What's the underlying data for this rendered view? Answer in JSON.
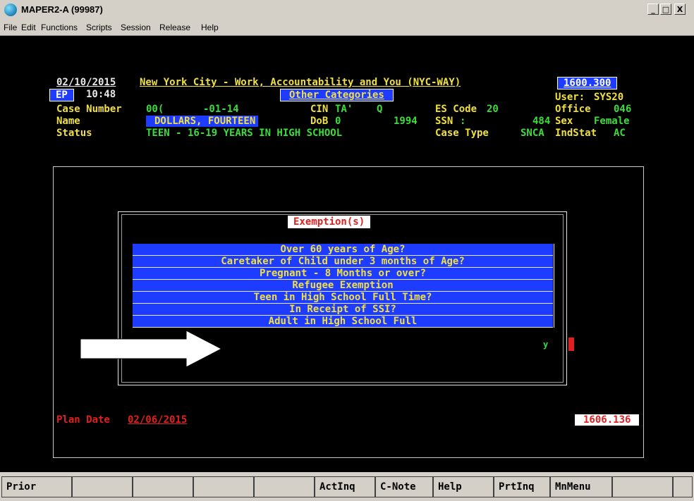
{
  "window": {
    "title": "MAPER2-A (99987)"
  },
  "window_buttons": {
    "minimize": "_",
    "maximize": "□",
    "close": "X"
  },
  "menu": [
    {
      "label": "File"
    },
    {
      "label": "Edit"
    },
    {
      "label": "Functions"
    },
    {
      "label": "Scripts"
    },
    {
      "label": "Session"
    },
    {
      "label": "Release"
    },
    {
      "label": "Help"
    }
  ],
  "header": {
    "date": "02/10/2015",
    "system_title": "New York City - Work, Accountability and You (NYC-WAY)",
    "screen_code": "1600.300",
    "mode": "EP",
    "time": "10:48",
    "category_tab": "Other Categories",
    "user_label": "User:",
    "user": "SYS20",
    "case_number_label": "Case Number",
    "case_number_a": "00(",
    "case_number_b": "-01-14",
    "cin_label": "CIN",
    "cin_a": "TA'",
    "cin_b": "Q",
    "es_code_label": "ES Code",
    "es_code": "20",
    "office_label": "Office",
    "office": "046",
    "name_label": "Name",
    "name": "DOLLARS, FOURTEEN",
    "dob_label": "DoB",
    "dob_a": "0",
    "dob_b": "1994",
    "ssn_label": "SSN",
    "ssn_a": ":",
    "ssn_b": "484",
    "sex_label": "Sex",
    "sex": "Female",
    "status_label": "Status",
    "status": "TEEN - 16-19 YEARS IN HIGH SCHOOL",
    "case_type_label": "Case Type",
    "case_type": "SNCA",
    "indstat_label": "IndStat",
    "indstat": "AC"
  },
  "dialog": {
    "title": "Exemption(s)",
    "options": [
      {
        "label": "Over 60 years of Age?"
      },
      {
        "label": "Caretaker of Child under 3 months of Age?"
      },
      {
        "label": "Pregnant - 8 Months or over?"
      },
      {
        "label": "Refugee Exemption"
      },
      {
        "label": "Teen in High School Full Time?"
      },
      {
        "label": "In Receipt of SSI?"
      },
      {
        "label": "Adult in High School Full"
      }
    ],
    "selected_value": "y"
  },
  "footer": {
    "plan_date_label": "Plan Date",
    "plan_date": "02/06/2015",
    "code": "1606.136"
  },
  "function_keys": [
    {
      "label": "Prior"
    },
    {
      "label": ""
    },
    {
      "label": ""
    },
    {
      "label": ""
    },
    {
      "label": ""
    },
    {
      "label": "ActInq"
    },
    {
      "label": "C-Note"
    },
    {
      "label": "Help"
    },
    {
      "label": "PrtInq"
    },
    {
      "label": "MnMenu"
    },
    {
      "label": ""
    },
    {
      "label": ""
    }
  ],
  "colors": {
    "terminal_bg": "#000000",
    "highlight_blue": "#1e3cff",
    "text_yellow": "#f0e040",
    "text_green": "#3cdc3c",
    "text_red": "#e02020"
  },
  "icons": {
    "app": "terminal-app-icon",
    "pointer": "arrow-pointer-icon"
  }
}
